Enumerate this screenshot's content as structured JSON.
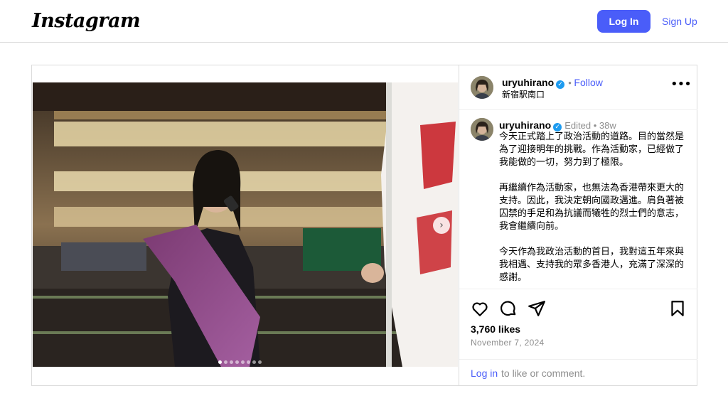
{
  "header": {
    "logo": "Instagram",
    "login_label": "Log In",
    "signup_label": "Sign Up"
  },
  "post": {
    "username": "uryuhirano",
    "follow_label": "Follow",
    "location": "新宿駅南口",
    "caption_meta": {
      "edited": "Edited",
      "age": "38w"
    },
    "caption_paragraphs": [
      "今天正式踏上了政治活動的道路。目的當然是為了迎接明年的挑戰。作為活動家，已經做了我能做的一切，努力到了極限。",
      "再繼續作為活動家，也無法為香港帶來更大的支持。因此，我決定朝向國政邁進。肩負著被囚禁的手足和為抗議而犧牲的烈士們的意志，我會繼續向前。",
      "今天作為我政治活動的首日，我對這五年來與我相遇、支持我的眾多香港人，充滿了深深的感謝。"
    ],
    "likes": "3,760 likes",
    "date": "November 7, 2024",
    "login_prompt_link": "Log in",
    "login_prompt_rest": "to like or comment.",
    "carousel": {
      "slide_count": 8,
      "active_slide": 1
    },
    "icons": [
      "heart-icon",
      "comment-icon",
      "share-icon",
      "bookmark-icon",
      "more-icon",
      "verified-icon",
      "chevron-right-icon"
    ]
  },
  "colors": {
    "accent": "#4a5df9",
    "verified": "#1d9bf0",
    "border": "#dbdbdb",
    "muted": "#8e8e8e"
  }
}
